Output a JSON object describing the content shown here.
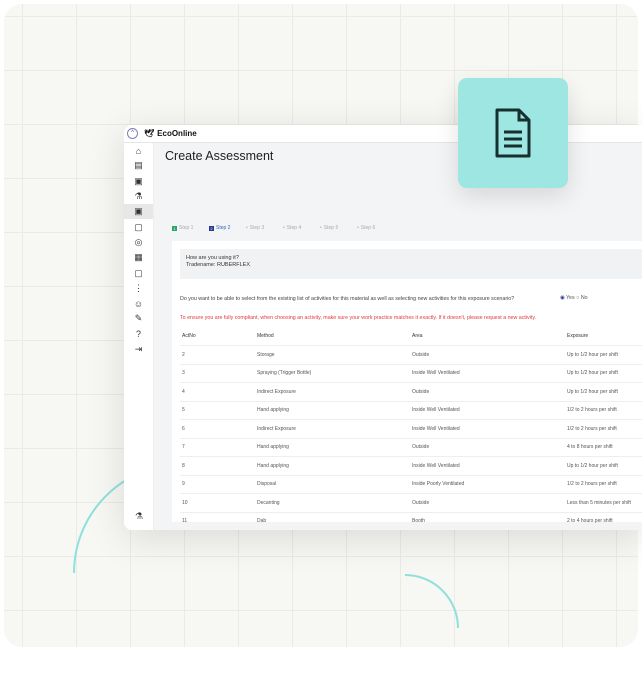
{
  "app": {
    "brand": "EcoOnline",
    "title": "Create Assessment"
  },
  "sidebar": [
    "home-icon",
    "building-icon",
    "clipboard-user-icon",
    "flask-icon",
    "clipboard-add-icon",
    "clipboard-check-icon",
    "location-icon",
    "calendar-icon",
    "checklist-icon",
    "more-icon",
    "user-icon",
    "document-edit-icon",
    "help-icon",
    "logout-icon"
  ],
  "steps": [
    "Step 1",
    "Step 2",
    "Step 3",
    "Step 4",
    "Step 5",
    "Step 6"
  ],
  "steps_nums": [
    "1",
    "2"
  ],
  "question_box": {
    "line1": "How are you using it?",
    "line2": "Tradename: RUBERFLEX"
  },
  "question": "Do you want to be able to select from the existing list of activities for this material as well as selecting new activities for this exposure scenario?",
  "radio": {
    "yes": "Yes",
    "no": "No",
    "selected": "Yes"
  },
  "warning": "To ensure you are fully compliant, when choosing an activity, make sure your work practice matches it exactly. If it doesn't, please request a new activity.",
  "table": {
    "headers": [
      "ActNo",
      "Method",
      "Area",
      "Exposure"
    ],
    "rows": [
      [
        "2",
        "Storage",
        "Outside",
        "Up to 1/2 hour per shift"
      ],
      [
        "3",
        "Spraying (Trigger Bottle)",
        "Inside Well Ventilated",
        "Up to 1/2 hour per shift"
      ],
      [
        "4",
        "Indirect Exposure",
        "Outside",
        "Up to 1/2 hour per shift"
      ],
      [
        "5",
        "Hand applying",
        "Inside Well Ventilated",
        "1/2 to 2 hours per shift"
      ],
      [
        "6",
        "Indirect Exposure",
        "Inside Well Ventilated",
        "1/2 to 2 hours per shift"
      ],
      [
        "7",
        "Hand applying",
        "Outside",
        "4 to 8 hours per shift"
      ],
      [
        "8",
        "Hand applying",
        "Inside Well Ventilated",
        "Up to 1/2 hour per shift"
      ],
      [
        "9",
        "Disposal",
        "Inside Poorly Ventilated",
        "1/2 to 2 hours per shift"
      ],
      [
        "10",
        "Decanting",
        "Outside",
        "Less than 5 minutes per shift"
      ],
      [
        "11",
        "Dab",
        "Booth",
        "2 to 4 hours per shift"
      ]
    ]
  },
  "colors": {
    "teal": "#9de6e2",
    "warning": "#e03a3a",
    "step_done": "#27a36b",
    "step_current": "#2c3590"
  }
}
